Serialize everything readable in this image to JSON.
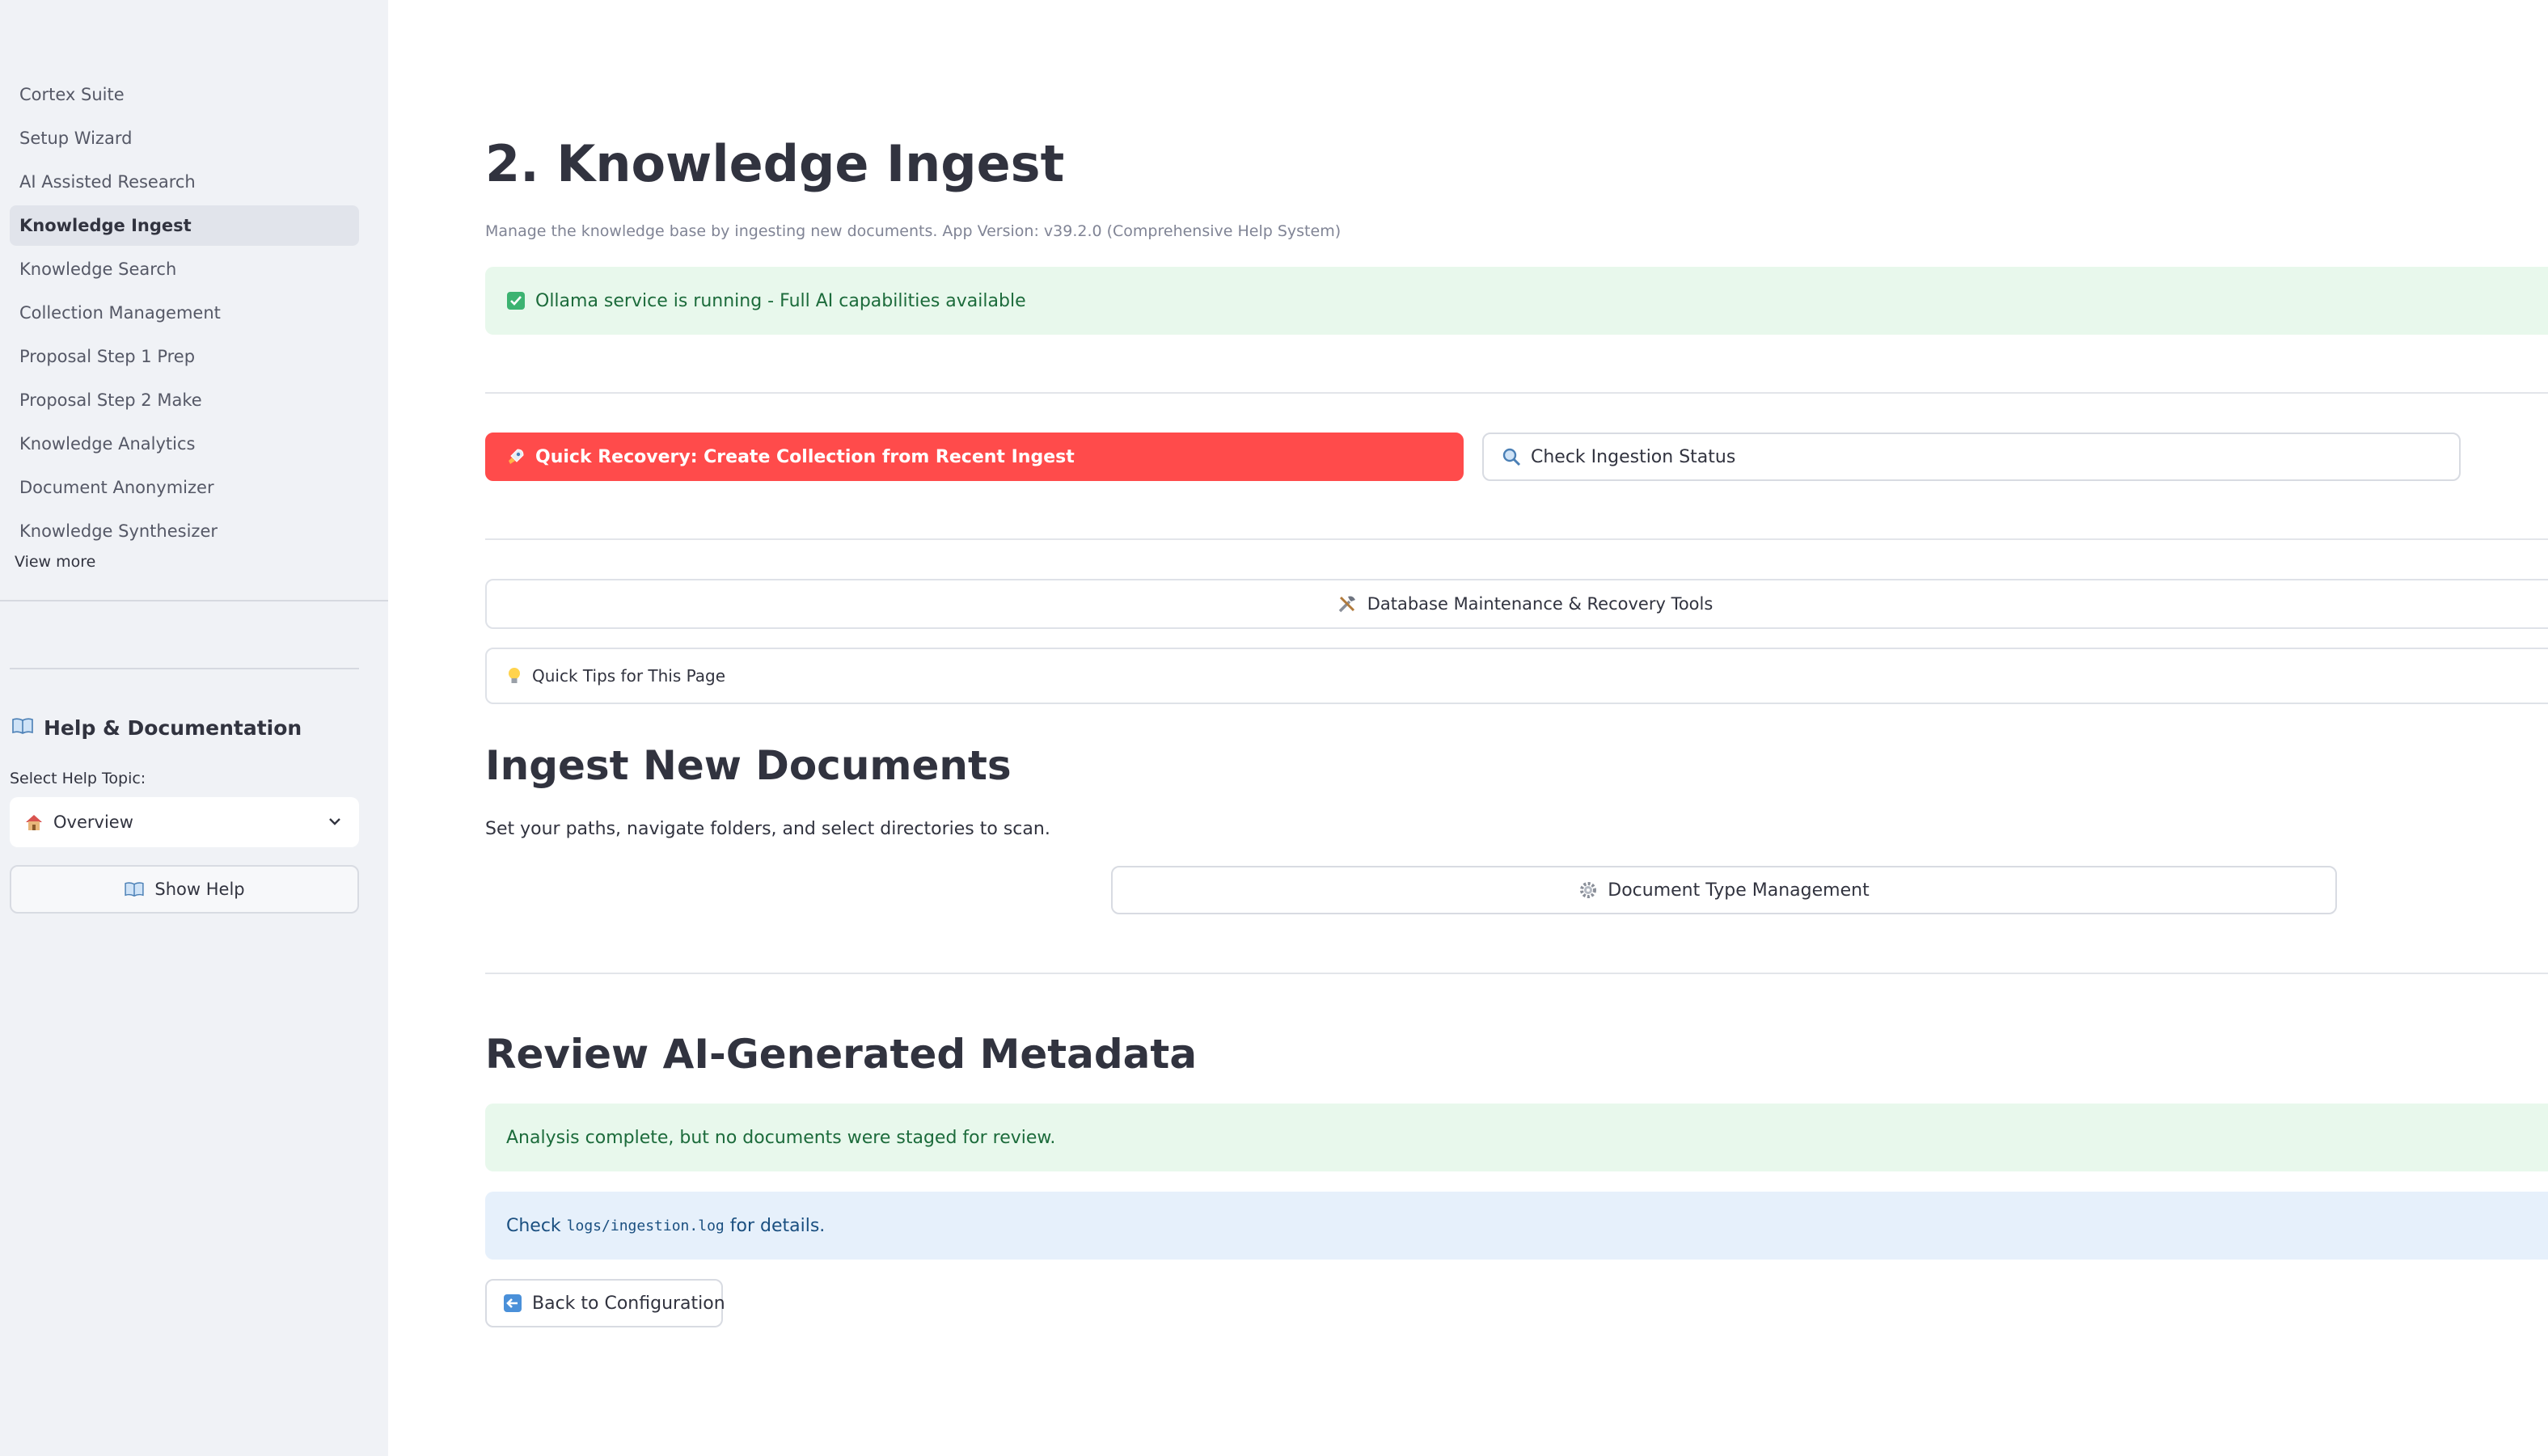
{
  "sidebar": {
    "nav_items": [
      {
        "label": "Cortex Suite"
      },
      {
        "label": "Setup Wizard"
      },
      {
        "label": "AI Assisted Research"
      },
      {
        "label": "Knowledge Ingest"
      },
      {
        "label": "Knowledge Search"
      },
      {
        "label": "Collection Management"
      },
      {
        "label": "Proposal Step 1 Prep"
      },
      {
        "label": "Proposal Step 2 Make"
      },
      {
        "label": "Knowledge Analytics"
      },
      {
        "label": "Document Anonymizer"
      },
      {
        "label": "Knowledge Synthesizer"
      }
    ],
    "active_item": "Knowledge Ingest",
    "view_more": "View more",
    "help": {
      "title": "Help & Documentation",
      "select_label": "Select Help Topic:",
      "selected_topic": "Overview",
      "show_help_label": "Show Help"
    }
  },
  "main": {
    "title": "2. Knowledge Ingest",
    "caption": "Manage the knowledge base by ingesting new documents. App Version: v39.2.0 (Comprehensive Help System)",
    "service_status": "Ollama service is running - Full AI capabilities available",
    "quick_recovery_label": "Quick Recovery: Create Collection from Recent Ingest",
    "check_status_label": "Check Ingestion Status",
    "maintenance_label": "Database Maintenance & Recovery Tools",
    "tips_label": "Quick Tips for This Page",
    "ingest_title": "Ingest New Documents",
    "ingest_desc": "Set your paths, navigate folders, and select directories to scan.",
    "doc_type_label": "Document Type Management",
    "review_title": "Review AI-Generated Metadata",
    "analysis_msg": "Analysis complete, but no documents were staged for review.",
    "log_prefix": "Check ",
    "log_path": "logs/ingestion.log",
    "log_suffix": " for details.",
    "back_label": "Back to Configuration"
  },
  "colors": {
    "primary": "#ff4b4b",
    "success_bg": "#e8f8ec",
    "info_bg": "#e6f0fb",
    "sidebar_bg": "#f0f2f6"
  }
}
